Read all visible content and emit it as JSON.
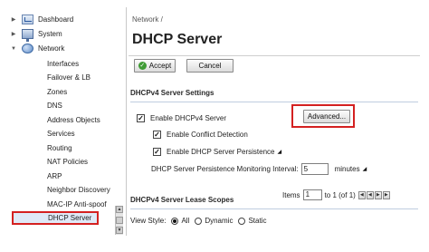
{
  "sidebar": {
    "top_items": [
      {
        "label": "Dashboard",
        "icon": "dashboard-icon",
        "expanded": false
      },
      {
        "label": "System",
        "icon": "monitor-icon",
        "expanded": false
      },
      {
        "label": "Network",
        "icon": "globe-icon",
        "expanded": true
      }
    ],
    "network_items": [
      "Interfaces",
      "Failover & LB",
      "Zones",
      "DNS",
      "Address Objects",
      "Services",
      "Routing",
      "NAT Policies",
      "ARP",
      "Neighbor Discovery",
      "MAC-IP Anti-spoof",
      "DHCP Server"
    ],
    "selected_item": "DHCP Server"
  },
  "main": {
    "breadcrumb": "Network /",
    "title": "DHCP Server",
    "accept_label": "Accept",
    "cancel_label": "Cancel",
    "v4_section": {
      "title": "DHCPv4 Server Settings",
      "enable_label": "Enable DHCPv4 Server",
      "enable_checked": true,
      "advanced_label": "Advanced...",
      "conflict_label": "Enable Conflict Detection",
      "conflict_checked": true,
      "persistence_label": "Enable DHCP Server Persistence",
      "persistence_checked": true,
      "interval_label": "DHCP Server Persistence Monitoring Interval:",
      "interval_value": "5",
      "interval_unit": "minutes"
    },
    "scopes_section": {
      "title": "DHCPv4 Server Lease Scopes",
      "items_label": "Items",
      "items_value": "1",
      "range_text": "to 1 (of 1)",
      "view_style_label": "View Style:",
      "view_options": [
        "All",
        "Dynamic",
        "Static"
      ],
      "view_selected": "All"
    }
  },
  "colors": {
    "highlight_border": "#d42121",
    "accept_icon": "#3f9b35",
    "selected_bg": "#dfe9f7"
  }
}
